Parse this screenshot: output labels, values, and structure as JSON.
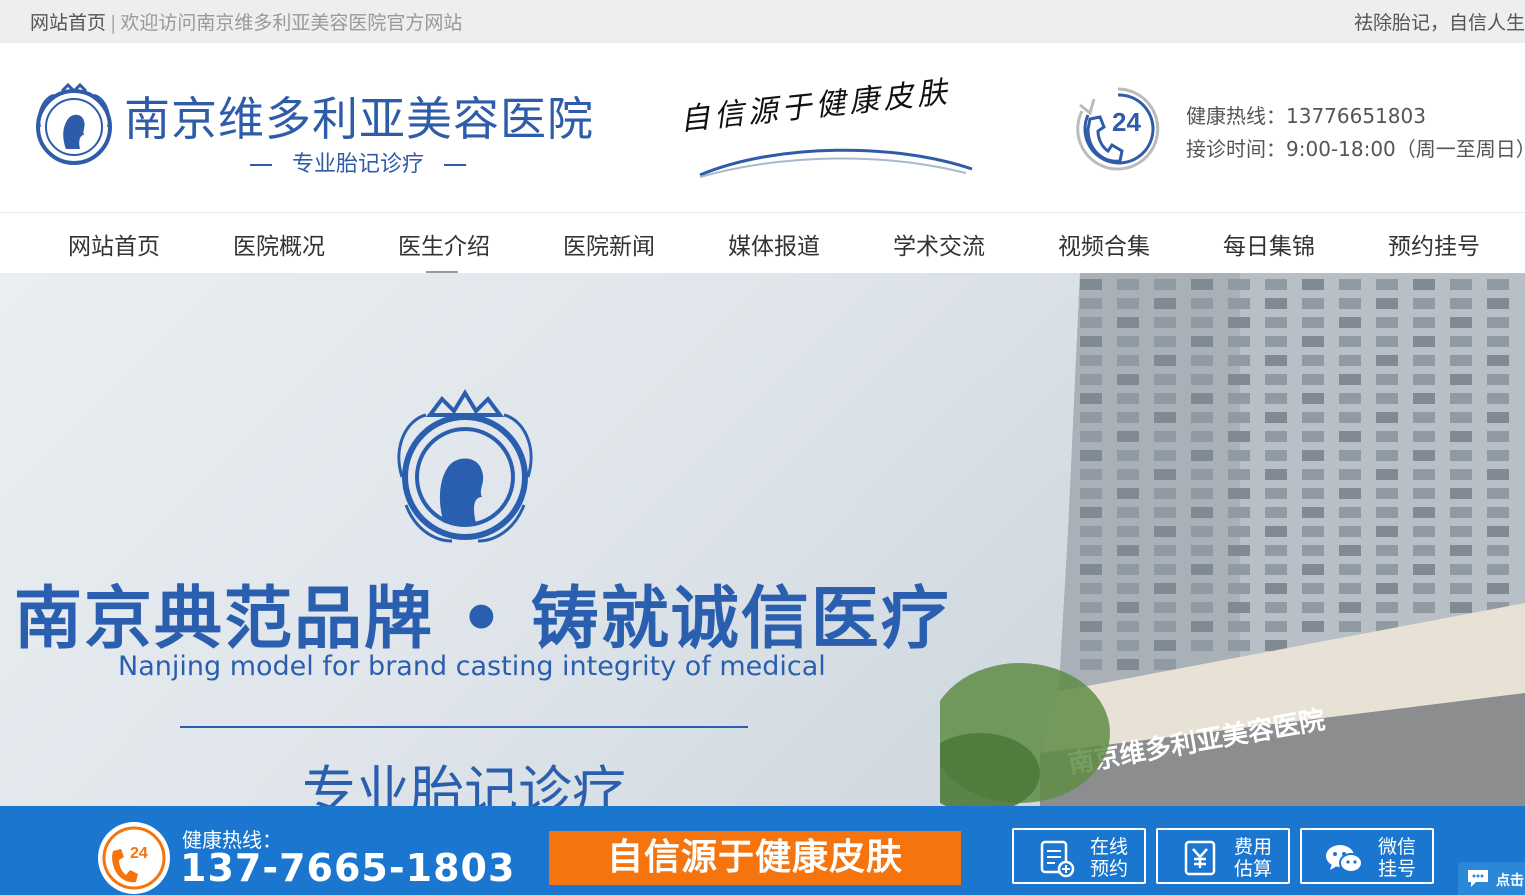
{
  "topbar": {
    "home_link": "网站首页",
    "separator": "|",
    "welcome": "欢迎访问南京维多利亚美容医院官方网站",
    "tagline": "祛除胎记，自信人生"
  },
  "header": {
    "logo_title": "南京维多利亚美容医院",
    "logo_subtitle": "专业胎记诊疗",
    "slogan": "自信源于健康皮肤",
    "phone_badge": "24",
    "hotline_label": "健康热线：",
    "hotline_number": "13776651803",
    "hours_label": "接诊时间：",
    "hours_value": "9:00-18:00（周一至周日）"
  },
  "nav": {
    "items": [
      {
        "label": "网站首页"
      },
      {
        "label": "医院概况"
      },
      {
        "label": "医生介绍"
      },
      {
        "label": "医院新闻"
      },
      {
        "label": "媒体报道"
      },
      {
        "label": "学术交流"
      },
      {
        "label": "视频合集"
      },
      {
        "label": "每日集锦"
      },
      {
        "label": "预约挂号"
      }
    ],
    "active_index": 2
  },
  "banner": {
    "title": "南京典范品牌 • 铸就诚信医疗",
    "english": "Nanjing model for brand casting integrity of medical",
    "subtitle": "专业胎记诊疗",
    "building_sign": "南京维多利亚美容医院"
  },
  "footer": {
    "phone_badge": "24",
    "hotline_label": "健康热线：",
    "hotline_number": "137-7665-1803",
    "slogan": "自信源于健康皮肤",
    "buttons": [
      {
        "line1": "在线",
        "line2": "预约",
        "icon": "clipboard-plus-icon"
      },
      {
        "line1": "费用",
        "line2": "估算",
        "icon": "yen-calculator-icon"
      },
      {
        "line1": "微信",
        "line2": "挂号",
        "icon": "wechat-icon"
      }
    ],
    "chat_label": "点击"
  },
  "colors": {
    "brand_blue": "#2f5ca8",
    "footer_blue": "#1a76cf",
    "orange": "#f5740e",
    "topbar_gray": "#eeeeee"
  }
}
